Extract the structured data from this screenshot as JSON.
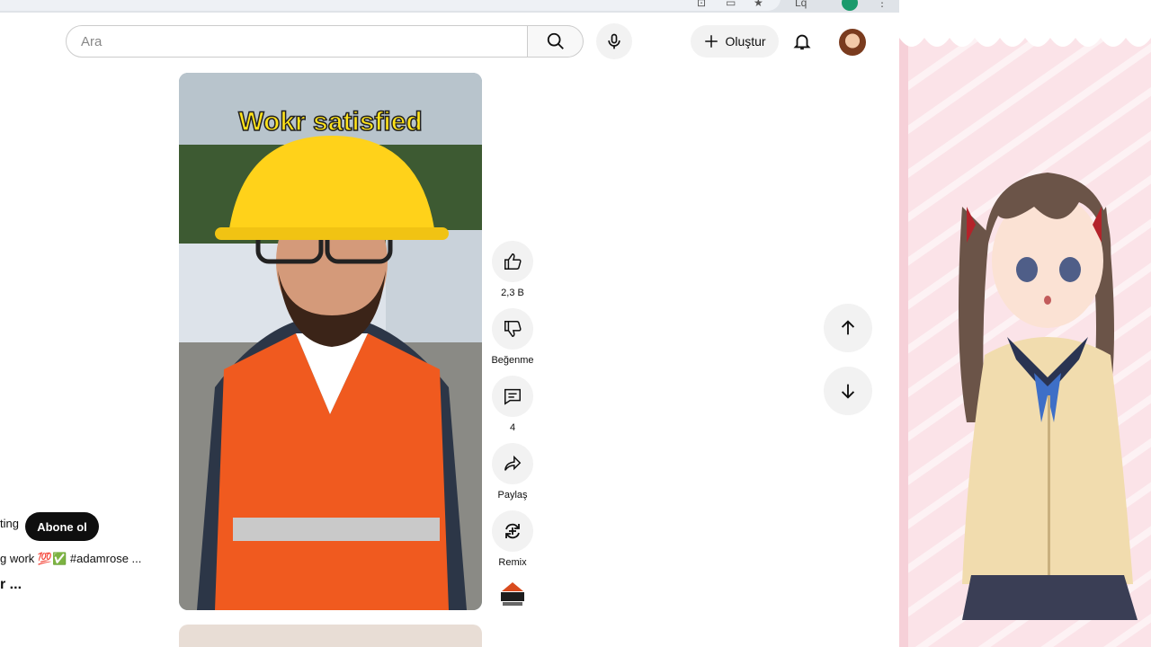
{
  "browser": {
    "url": "/shorts/...",
    "profile_initial": "Lq"
  },
  "header": {
    "search_placeholder": "Ara",
    "create_label": "Oluştur"
  },
  "video": {
    "caption": "Wokr satisfied"
  },
  "actions": [
    {
      "name": "like",
      "label": "2,3 B"
    },
    {
      "name": "dislike",
      "label": "Beğenme"
    },
    {
      "name": "comments",
      "label": "4"
    },
    {
      "name": "share",
      "label": "Paylaş"
    },
    {
      "name": "remix",
      "label": "Remix"
    }
  ],
  "channel": {
    "name_fragment": "ting",
    "subscribe_label": "Abone ol",
    "description_fragment": "g work 💯✅ #adamrose ...",
    "title_fragment": "r ..."
  },
  "icons": {
    "search": "search-icon",
    "mic": "mic-icon",
    "create": "plus-icon",
    "bell": "bell-icon",
    "like": "thumbs-up-icon",
    "dislike": "thumbs-down-icon",
    "comments": "comment-icon",
    "share": "share-icon",
    "remix": "remix-icon",
    "up": "arrow-up-icon",
    "down": "arrow-down-icon"
  }
}
